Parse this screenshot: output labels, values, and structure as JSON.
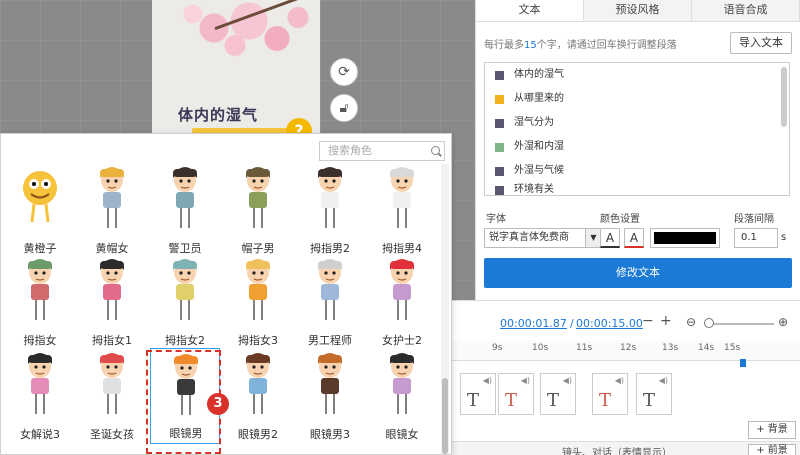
{
  "slide": {
    "title": "体内的湿气",
    "badge": "?"
  },
  "tools": {
    "rotate_icon": "rotate-icon",
    "lock_icon": "lock-icon"
  },
  "tabs": [
    {
      "label": "文本",
      "active": true
    },
    {
      "label": "预设风格",
      "active": false
    },
    {
      "label": "语音合成",
      "active": false
    }
  ],
  "text_panel": {
    "hint_pre": "每行最多",
    "hint_num": "15",
    "hint_post": "个字，请通过回车换行调整段落",
    "import_label": "导入文本",
    "paragraphs": [
      {
        "text": "体内的湿气",
        "color": "#5b5570"
      },
      {
        "text": "从哪里来的",
        "color": "#f2b01e"
      },
      {
        "text": "湿气分为",
        "color": "#5b5570"
      },
      {
        "text": "外湿和内湿",
        "color": "#7fb38a"
      },
      {
        "text": "外湿与气候",
        "color": "#5b5570"
      },
      {
        "text": "环境有关",
        "color": "#5b5570"
      }
    ],
    "font_label": "字体",
    "font_value": "锐字真言体免费商",
    "color_label": "颜色设置",
    "color_value": "#000000",
    "spacing_label": "段落间隔",
    "spacing_value": "0.1",
    "spacing_unit": "s",
    "modify_label": "修改文本"
  },
  "timeline": {
    "current": "00:00:01.87",
    "separator": "/",
    "total": "00:00:15.00",
    "minus": "−",
    "plus": "+",
    "ticks": [
      "9s",
      "10s",
      "11s",
      "12s",
      "13s",
      "14s",
      "15s"
    ],
    "clip_glyph": "T",
    "bg_label": "+ 背景",
    "fg_label": "+ 前景",
    "bottom_text": "镜头、对话（表情显示）"
  },
  "picker": {
    "search_placeholder": "搜索角色",
    "step_badge": "3",
    "rows": [
      [
        "黄橙子",
        "黄帽女",
        "警卫员",
        "帽子男",
        "拇指男2",
        "拇指男4"
      ],
      [
        "拇指女",
        "拇指女1",
        "拇指女2",
        "拇指女3",
        "男工程师",
        "女护士2"
      ],
      [
        "女解说3",
        "圣诞女孩",
        "眼镜男",
        "眼镜男2",
        "眼镜男3",
        "眼镜女"
      ]
    ],
    "selected": "眼镜男"
  }
}
